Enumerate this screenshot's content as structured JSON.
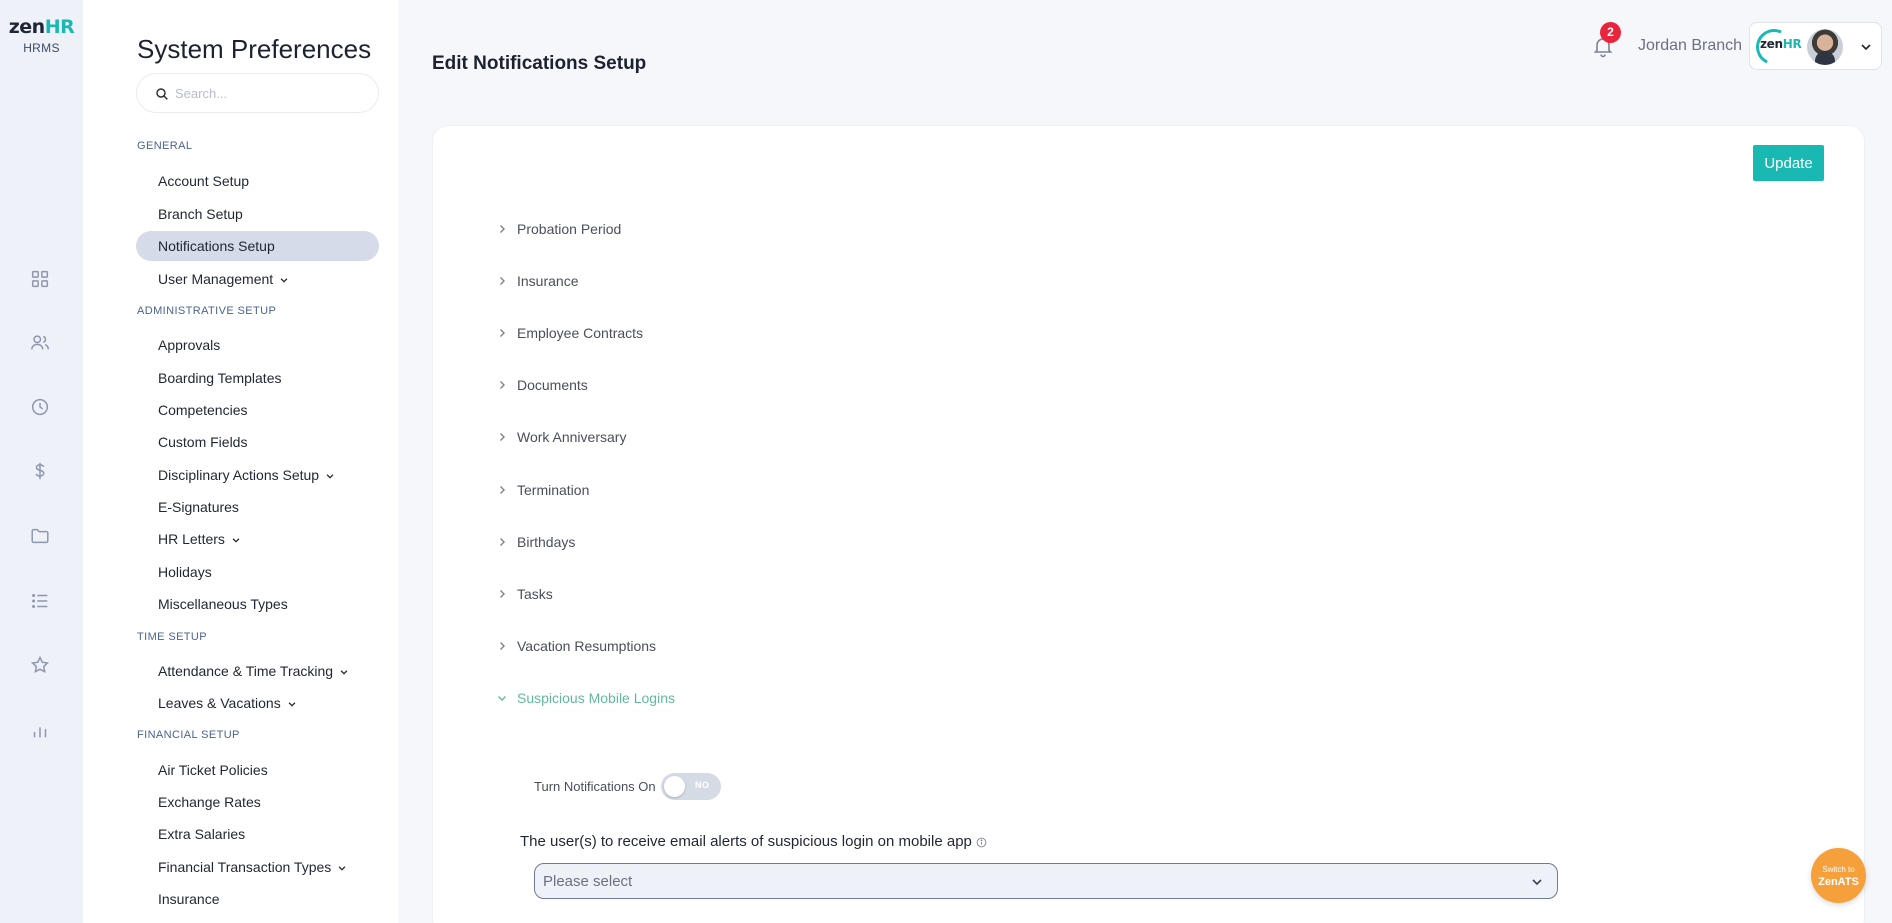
{
  "brand": {
    "logo_main": "zen",
    "logo_accent": "HR",
    "logo_sub": "HRMS"
  },
  "rail_icons": [
    "dashboard-icon",
    "people-icon",
    "clock-icon",
    "dollar-icon",
    "folder-icon",
    "list-icon",
    "star-icon",
    "bar-chart-icon"
  ],
  "sidebar": {
    "title": "System Preferences",
    "search_placeholder": "Search...",
    "sections": {
      "general": "GENERAL",
      "administrative": "ADMINISTRATIVE SETUP",
      "time": "TIME SETUP",
      "financial": "FINANCIAL SETUP"
    },
    "items": {
      "account_setup": "Account Setup",
      "branch_setup": "Branch Setup",
      "notifications_setup": "Notifications Setup",
      "user_management": "User Management",
      "approvals": "Approvals",
      "boarding_templates": "Boarding Templates",
      "competencies": "Competencies",
      "custom_fields": "Custom Fields",
      "disciplinary_actions": "Disciplinary Actions Setup",
      "e_signatures": "E-Signatures",
      "hr_letters": "HR Letters",
      "holidays": "Holidays",
      "misc_types": "Miscellaneous Types",
      "attendance": "Attendance & Time Tracking",
      "leaves": "Leaves & Vacations",
      "air_ticket": "Air Ticket Policies",
      "exchange_rates": "Exchange Rates",
      "extra_salaries": "Extra Salaries",
      "financial_transaction_types": "Financial Transaction Types",
      "insurance": "Insurance"
    },
    "active_item": "Notifications Setup"
  },
  "header": {
    "page_title": "Edit Notifications Setup",
    "notification_count": "2",
    "user_name": "Jordan Branch",
    "mini_logo_main": "zen",
    "mini_logo_accent": "HR"
  },
  "main": {
    "update_label": "Update",
    "accordion": {
      "probation": "Probation Period",
      "insurance": "Insurance",
      "contracts": "Employee Contracts",
      "documents": "Documents",
      "anniversary": "Work Anniversary",
      "termination": "Termination",
      "birthdays": "Birthdays",
      "tasks": "Tasks",
      "vacation_resumptions": "Vacation Resumptions",
      "suspicious_logins": "Suspicious Mobile Logins"
    },
    "expanded_section": "Suspicious Mobile Logins",
    "toggle_label": "Turn Notifications On",
    "toggle_state": "NO",
    "field_label": "The user(s) to receive email alerts of suspicious login on mobile app",
    "select_placeholder": "Please select"
  },
  "fab": {
    "line1": "Switch to",
    "line2": "ZenATS"
  },
  "colors": {
    "accent": "#19b8b3",
    "open_section": "#63b99b",
    "badge": "#e8253c",
    "fab": "#f6a03c"
  }
}
